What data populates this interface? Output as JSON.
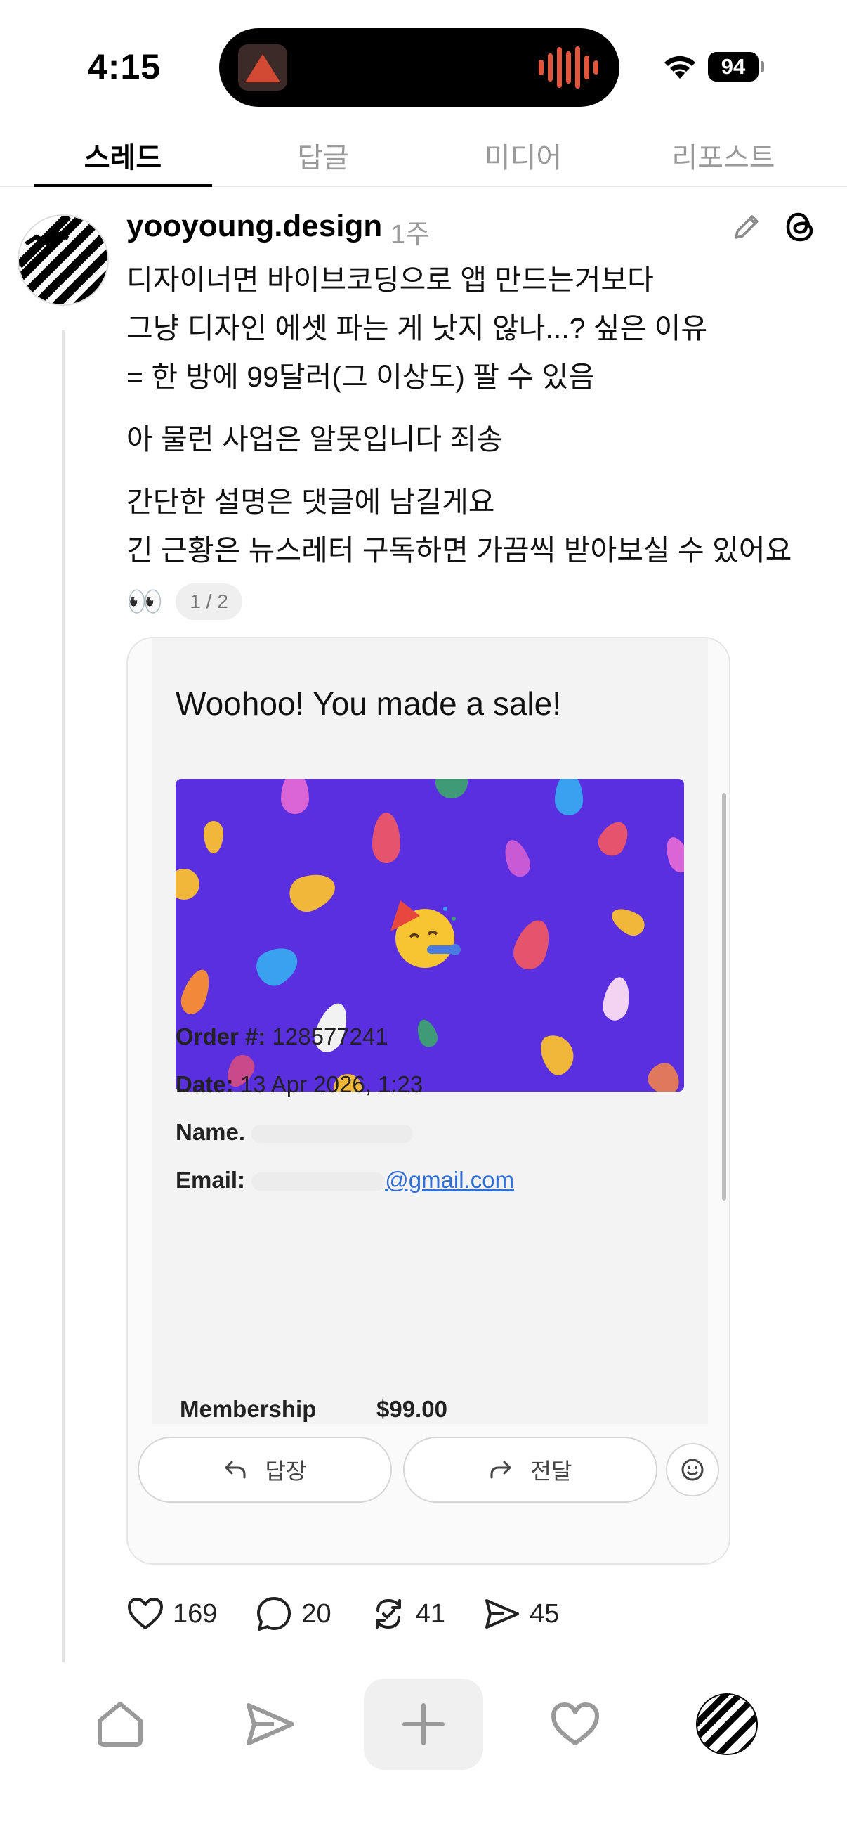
{
  "status_bar": {
    "time": "4:15",
    "battery": "94"
  },
  "tabs": [
    {
      "label": "스레드",
      "active": true
    },
    {
      "label": "답글",
      "active": false
    },
    {
      "label": "미디어",
      "active": false
    },
    {
      "label": "리포스트",
      "active": false
    }
  ],
  "post": {
    "username": "yooyoung.design",
    "time": "1주",
    "lines": [
      "디자이너면 바이브코딩으로 앱 만드는거보다",
      "그냥 디자인 에셋 파는 게 낫지 않나...? 싶은 이유",
      "= 한 방에 99달러(그 이상도) 팔 수 있음",
      "아 물런 사업은 알못입니다 죄송",
      "간단한 설명은 댓글에 남길게요",
      "긴 근황은 뉴스레터 구독하면 가끔씩 받아보실 수 있어요"
    ],
    "eyes": "👀",
    "page_indicator": "1 / 2"
  },
  "card": {
    "email_title": "Woohoo! You made a sale!",
    "order_label": "Order #:",
    "order_value": "128577241",
    "date_label": "Date:",
    "date_value": "13 Apr 2026, 1:23",
    "name_label": "Name.",
    "email_label": "Email:",
    "email_value": "@gmail.com",
    "membership_label": "Membership",
    "membership_price": "$99.00",
    "reply_label": "답장",
    "forward_label": "전달"
  },
  "actions": {
    "likes": "169",
    "comments": "20",
    "reposts": "41",
    "shares": "45"
  },
  "colors": {
    "banner": "#5a2fe0",
    "link": "#2f6fd6",
    "muted": "#9a9a9a"
  },
  "icons": [
    "edit-icon",
    "threads-icon",
    "heart-icon",
    "comment-icon",
    "repost-icon",
    "share-icon",
    "home-icon",
    "send-icon",
    "plus-icon",
    "activity-icon"
  ]
}
